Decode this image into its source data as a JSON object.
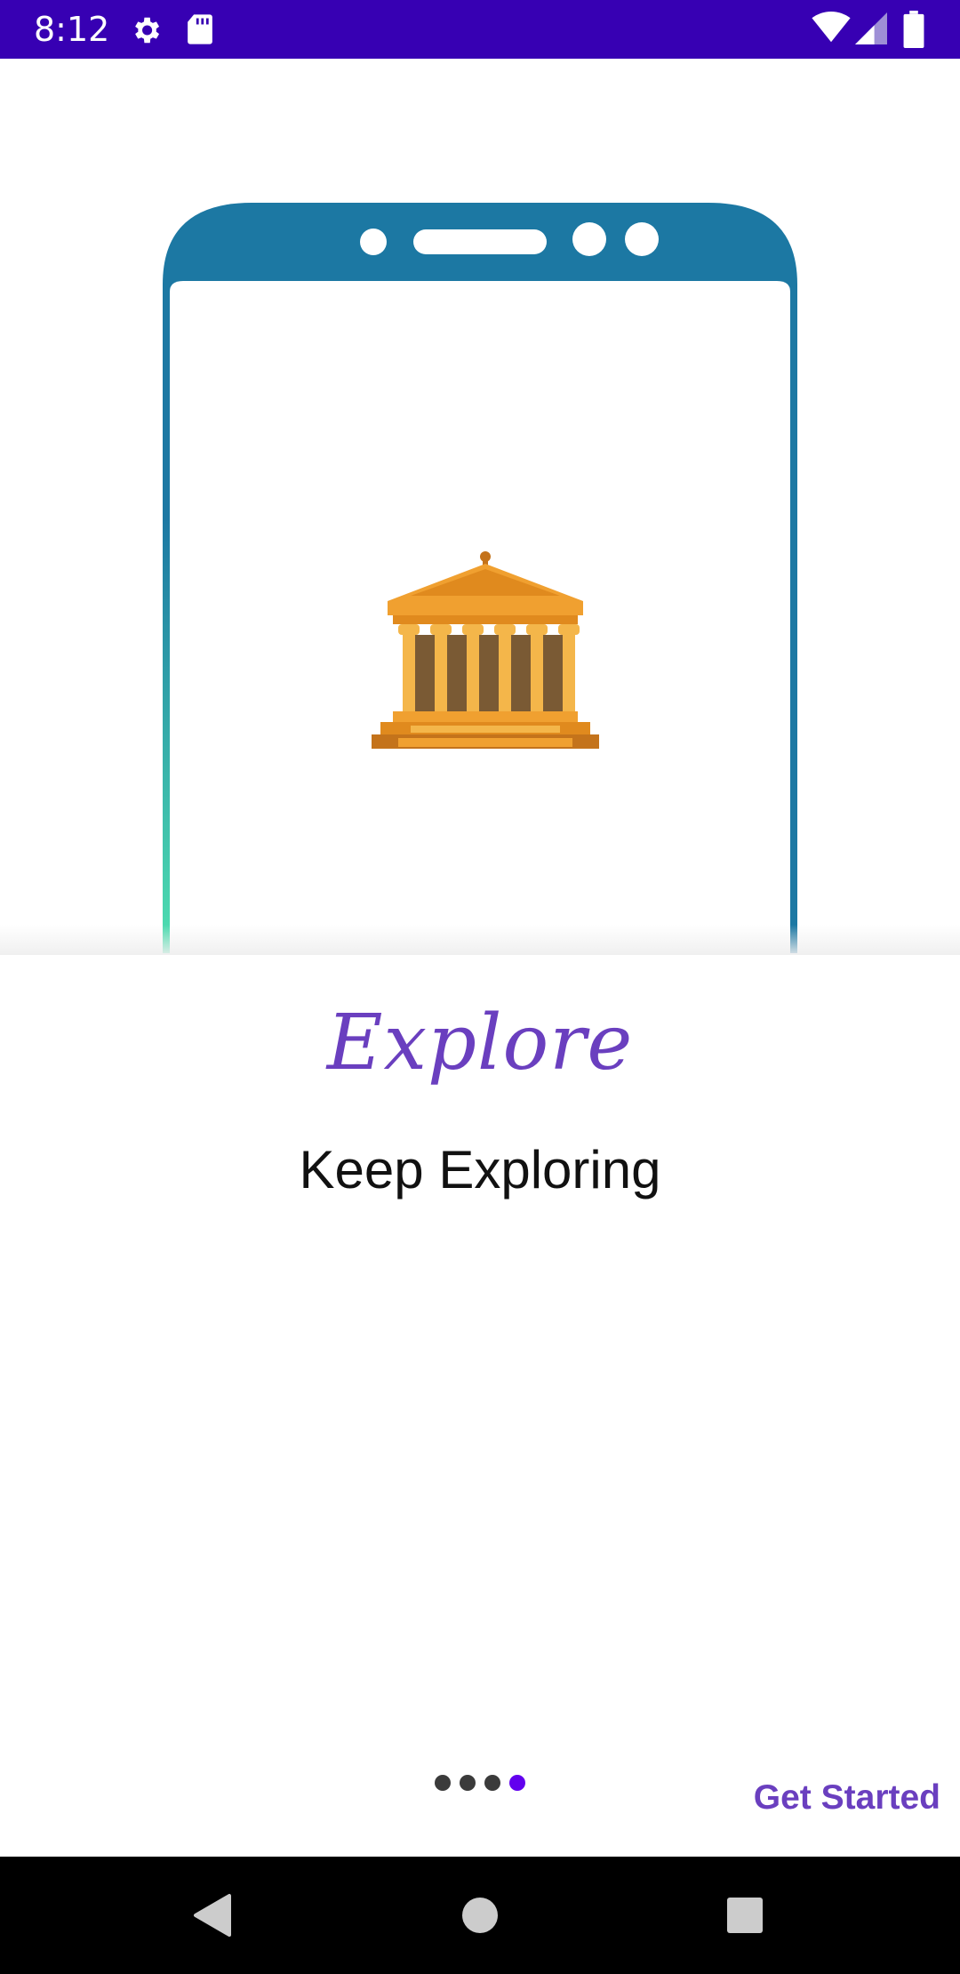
{
  "status_bar": {
    "time": "8:12",
    "icons": [
      "gear-icon",
      "sd-card-icon",
      "wifi-icon",
      "signal-icon",
      "battery-icon"
    ],
    "background": "#3700b3"
  },
  "onboarding": {
    "illustration": "temple-icon",
    "brand_title": "Explore",
    "subtitle": "Keep Exploring",
    "pager": {
      "total": 4,
      "active_index": 3
    },
    "get_started_label": "Get Started"
  },
  "nav_bar": {
    "buttons": [
      "back-icon",
      "home-icon",
      "recents-icon"
    ]
  },
  "colors": {
    "accent": "#6a3fbf",
    "pager_active": "#6200ee",
    "phone_frame": "#1c78a3",
    "temple": "#f0a030"
  }
}
